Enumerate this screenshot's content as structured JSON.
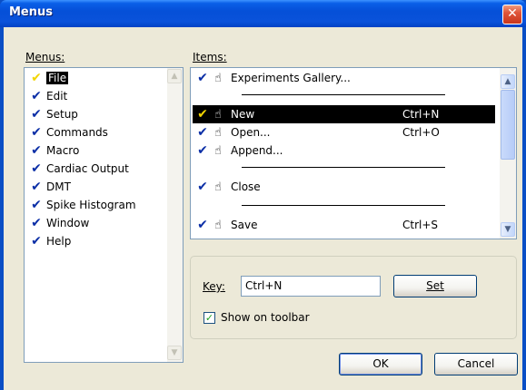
{
  "window": {
    "title": "Menus",
    "close_glyph": "✕"
  },
  "menus": {
    "label": "Menus:",
    "items": [
      {
        "label": "File",
        "selected": true
      },
      {
        "label": "Edit"
      },
      {
        "label": "Setup"
      },
      {
        "label": "Commands"
      },
      {
        "label": "Macro"
      },
      {
        "label": "Cardiac Output"
      },
      {
        "label": "DMT"
      },
      {
        "label": "Spike Histogram"
      },
      {
        "label": "Window"
      },
      {
        "label": "Help"
      }
    ]
  },
  "items": {
    "label": "Items:",
    "rows": [
      {
        "label": "Experiments Gallery...",
        "shortcut": ""
      },
      {
        "separator": true
      },
      {
        "label": "New",
        "shortcut": "Ctrl+N",
        "selected": true
      },
      {
        "label": "Open...",
        "shortcut": "Ctrl+O"
      },
      {
        "label": "Append...",
        "shortcut": ""
      },
      {
        "separator": true
      },
      {
        "label": "Close",
        "shortcut": ""
      },
      {
        "separator": true
      },
      {
        "label": "Save",
        "shortcut": "Ctrl+S"
      }
    ]
  },
  "key": {
    "label": "Key:",
    "value": "Ctrl+N",
    "set_button": "Set"
  },
  "toolbar_checkbox": {
    "label": "Show on toolbar",
    "checked": true
  },
  "buttons": {
    "ok": "OK",
    "cancel": "Cancel"
  },
  "icons": {
    "check": "checkmark-icon",
    "hand": "hand-pointer-icon",
    "scroll_up": "scroll-up-arrow-icon",
    "scroll_down": "scroll-down-arrow-icon"
  },
  "colors": {
    "title_bar": "#0550d8",
    "selection": "#000000",
    "check_default": "#0b2ea6",
    "check_selected": "#f2d500",
    "close_button": "#e0553a"
  }
}
